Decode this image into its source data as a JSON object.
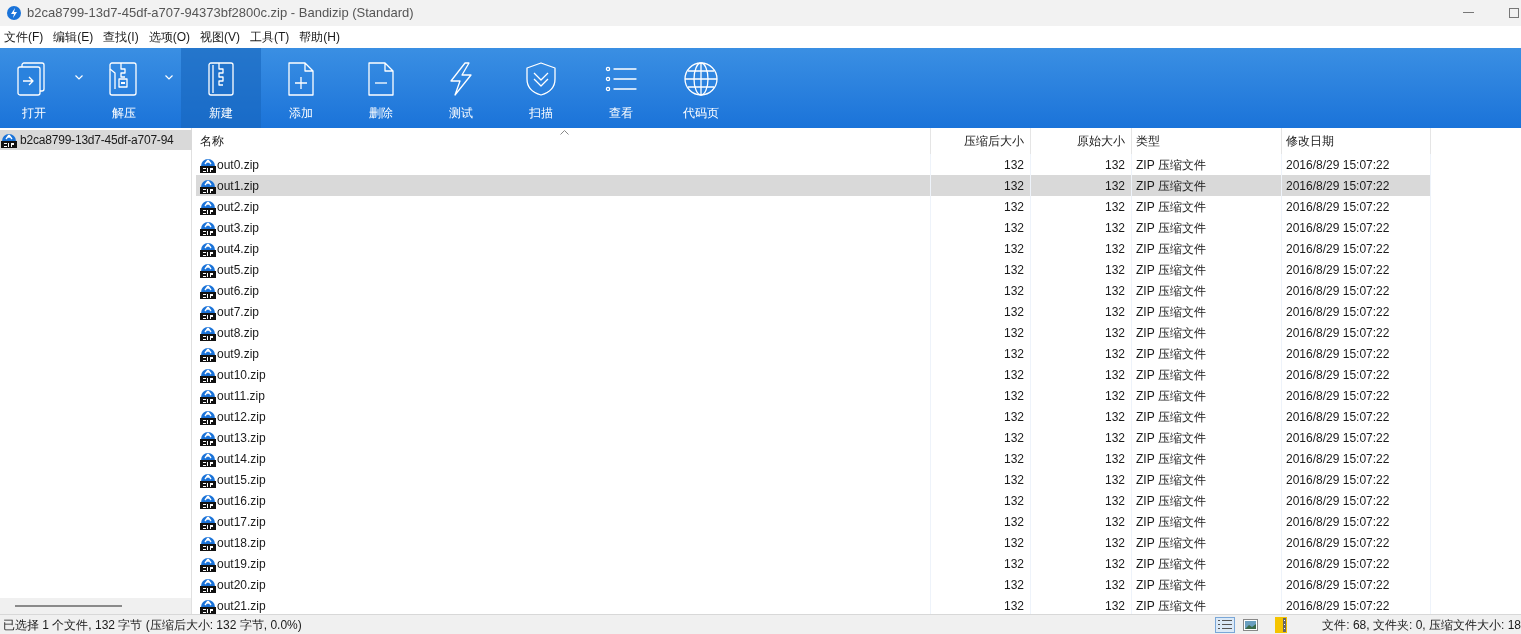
{
  "window": {
    "title": "b2ca8799-13d7-45df-a707-94373bf2800c.zip - Bandizip (Standard)"
  },
  "menu": [
    "文件(F)",
    "编辑(E)",
    "查找(I)",
    "选项(O)",
    "视图(V)",
    "工具(T)",
    "帮助(H)"
  ],
  "toolbar": [
    {
      "label": "打开",
      "kind": "open",
      "dropdown": true,
      "selected": false
    },
    {
      "label": "解压",
      "kind": "extract",
      "dropdown": true,
      "selected": false
    },
    {
      "label": "新建",
      "kind": "new",
      "dropdown": false,
      "selected": true
    },
    {
      "label": "添加",
      "kind": "add",
      "dropdown": false,
      "selected": false
    },
    {
      "label": "删除",
      "kind": "delete",
      "dropdown": false,
      "selected": false
    },
    {
      "label": "测试",
      "kind": "test",
      "dropdown": false,
      "selected": false
    },
    {
      "label": "扫描",
      "kind": "scan",
      "dropdown": false,
      "selected": false
    },
    {
      "label": "查看",
      "kind": "view",
      "dropdown": false,
      "selected": false
    },
    {
      "label": "代码页",
      "kind": "codepage",
      "dropdown": false,
      "selected": false
    }
  ],
  "tree": [
    {
      "label": "b2ca8799-13d7-45df-a707-94",
      "selected": true
    }
  ],
  "table": {
    "columns": [
      "名称",
      "压缩后大小",
      "原始大小",
      "类型",
      "修改日期"
    ],
    "rows": [
      {
        "name": "out0.zip",
        "packed": "132",
        "size": "132",
        "type": "ZIP 压缩文件",
        "modified": "2016/8/29 15:07:22",
        "selected": false
      },
      {
        "name": "out1.zip",
        "packed": "132",
        "size": "132",
        "type": "ZIP 压缩文件",
        "modified": "2016/8/29 15:07:22",
        "selected": true
      },
      {
        "name": "out2.zip",
        "packed": "132",
        "size": "132",
        "type": "ZIP 压缩文件",
        "modified": "2016/8/29 15:07:22",
        "selected": false
      },
      {
        "name": "out3.zip",
        "packed": "132",
        "size": "132",
        "type": "ZIP 压缩文件",
        "modified": "2016/8/29 15:07:22",
        "selected": false
      },
      {
        "name": "out4.zip",
        "packed": "132",
        "size": "132",
        "type": "ZIP 压缩文件",
        "modified": "2016/8/29 15:07:22",
        "selected": false
      },
      {
        "name": "out5.zip",
        "packed": "132",
        "size": "132",
        "type": "ZIP 压缩文件",
        "modified": "2016/8/29 15:07:22",
        "selected": false
      },
      {
        "name": "out6.zip",
        "packed": "132",
        "size": "132",
        "type": "ZIP 压缩文件",
        "modified": "2016/8/29 15:07:22",
        "selected": false
      },
      {
        "name": "out7.zip",
        "packed": "132",
        "size": "132",
        "type": "ZIP 压缩文件",
        "modified": "2016/8/29 15:07:22",
        "selected": false
      },
      {
        "name": "out8.zip",
        "packed": "132",
        "size": "132",
        "type": "ZIP 压缩文件",
        "modified": "2016/8/29 15:07:22",
        "selected": false
      },
      {
        "name": "out9.zip",
        "packed": "132",
        "size": "132",
        "type": "ZIP 压缩文件",
        "modified": "2016/8/29 15:07:22",
        "selected": false
      },
      {
        "name": "out10.zip",
        "packed": "132",
        "size": "132",
        "type": "ZIP 压缩文件",
        "modified": "2016/8/29 15:07:22",
        "selected": false
      },
      {
        "name": "out11.zip",
        "packed": "132",
        "size": "132",
        "type": "ZIP 压缩文件",
        "modified": "2016/8/29 15:07:22",
        "selected": false
      },
      {
        "name": "out12.zip",
        "packed": "132",
        "size": "132",
        "type": "ZIP 压缩文件",
        "modified": "2016/8/29 15:07:22",
        "selected": false
      },
      {
        "name": "out13.zip",
        "packed": "132",
        "size": "132",
        "type": "ZIP 压缩文件",
        "modified": "2016/8/29 15:07:22",
        "selected": false
      },
      {
        "name": "out14.zip",
        "packed": "132",
        "size": "132",
        "type": "ZIP 压缩文件",
        "modified": "2016/8/29 15:07:22",
        "selected": false
      },
      {
        "name": "out15.zip",
        "packed": "132",
        "size": "132",
        "type": "ZIP 压缩文件",
        "modified": "2016/8/29 15:07:22",
        "selected": false
      },
      {
        "name": "out16.zip",
        "packed": "132",
        "size": "132",
        "type": "ZIP 压缩文件",
        "modified": "2016/8/29 15:07:22",
        "selected": false
      },
      {
        "name": "out17.zip",
        "packed": "132",
        "size": "132",
        "type": "ZIP 压缩文件",
        "modified": "2016/8/29 15:07:22",
        "selected": false
      },
      {
        "name": "out18.zip",
        "packed": "132",
        "size": "132",
        "type": "ZIP 压缩文件",
        "modified": "2016/8/29 15:07:22",
        "selected": false
      },
      {
        "name": "out19.zip",
        "packed": "132",
        "size": "132",
        "type": "ZIP 压缩文件",
        "modified": "2016/8/29 15:07:22",
        "selected": false
      },
      {
        "name": "out20.zip",
        "packed": "132",
        "size": "132",
        "type": "ZIP 压缩文件",
        "modified": "2016/8/29 15:07:22",
        "selected": false
      },
      {
        "name": "out21.zip",
        "packed": "132",
        "size": "132",
        "type": "ZIP 压缩文件",
        "modified": "2016/8/29 15:07:22",
        "selected": false
      }
    ]
  },
  "status_bar": {
    "selection": "已选择 1 个文件, 132 字节 (压缩后大小: 132 字节, 0.0%)",
    "summary": "文件: 68, 文件夹: 0, 压缩文件大小: 18"
  }
}
